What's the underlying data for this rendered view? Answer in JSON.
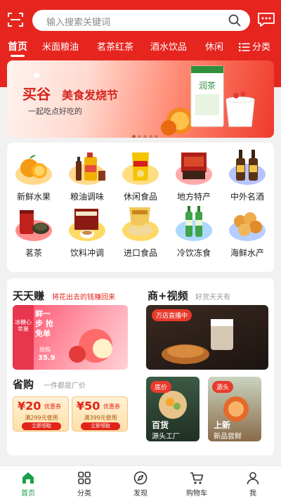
{
  "header": {
    "search_placeholder": "输入搜索关键词"
  },
  "tabs": [
    {
      "label": "首页",
      "active": true
    },
    {
      "label": "米面粮油"
    },
    {
      "label": "茗茶红茶"
    },
    {
      "label": "酒水饮品"
    },
    {
      "label": "休闲"
    }
  ],
  "category_button": "分类",
  "banner": {
    "brand": "买谷",
    "title": "美食发烧节",
    "subtitle": "一起吃点好吃的",
    "product_text": "润茶",
    "page_count": 5,
    "active_index": 0
  },
  "categories": [
    {
      "label": "新鲜水果",
      "icon": "orange-icon",
      "plate": "#ffd27a"
    },
    {
      "label": "粮油调味",
      "icon": "oil-bottle-icon",
      "plate": "#ffd27a"
    },
    {
      "label": "休闲食品",
      "icon": "chips-bag-icon",
      "plate": "#ffd86b"
    },
    {
      "label": "地方特产",
      "icon": "gift-box-icon",
      "plate": "#ff9b9b"
    },
    {
      "label": "中外名酒",
      "icon": "wine-bottle-icon",
      "plate": "#a9b9ff"
    },
    {
      "label": "茗茶",
      "icon": "tea-can-icon",
      "plate": "#ff7a7a"
    },
    {
      "label": "饮料冲调",
      "icon": "coffee-box-icon",
      "plate": "#ffd24a"
    },
    {
      "label": "进口食品",
      "icon": "snack-bag-icon",
      "plate": "#ffd24a"
    },
    {
      "label": "冷饮冻食",
      "icon": "soda-bottle-icon",
      "plate": "#9fd2ff"
    },
    {
      "label": "海鲜水产",
      "icon": "seafood-icon",
      "plate": "#a9c4ff"
    }
  ],
  "promo": {
    "daily": {
      "title": "天天赚",
      "subtitle": "将花出去的钱赚回来",
      "ad_text": "鲜一步 抢免单",
      "ad_side": "冰糖心苹果",
      "price_label": "抢购",
      "price": "35.9"
    },
    "video": {
      "title": "商+视频",
      "subtitle": "好货天天有",
      "live_tag": "万店直播中"
    },
    "save": {
      "title": "省购",
      "subtitle": "一件都是厂价"
    },
    "coupons": [
      {
        "amount": "¥20",
        "unit": "优惠券",
        "condition": "满299元使用",
        "button": "立即领取"
      },
      {
        "amount": "¥50",
        "unit": "优惠券",
        "condition": "满399元使用",
        "button": "立即领取"
      }
    ],
    "cards": [
      {
        "tag": "底价",
        "line1": "百货",
        "line2": "源头工厂"
      },
      {
        "tag": "源头",
        "line1": "上新",
        "line2": "新品尝鲜"
      }
    ]
  },
  "bottom_nav": [
    {
      "label": "首页",
      "icon": "home-icon",
      "active": true
    },
    {
      "label": "分类",
      "icon": "grid-icon"
    },
    {
      "label": "发现",
      "icon": "compass-icon"
    },
    {
      "label": "购物车",
      "icon": "cart-icon"
    },
    {
      "label": "我",
      "icon": "user-icon"
    }
  ],
  "colors": {
    "brand_red": "#e6251f",
    "active_green": "#1aa04a"
  }
}
